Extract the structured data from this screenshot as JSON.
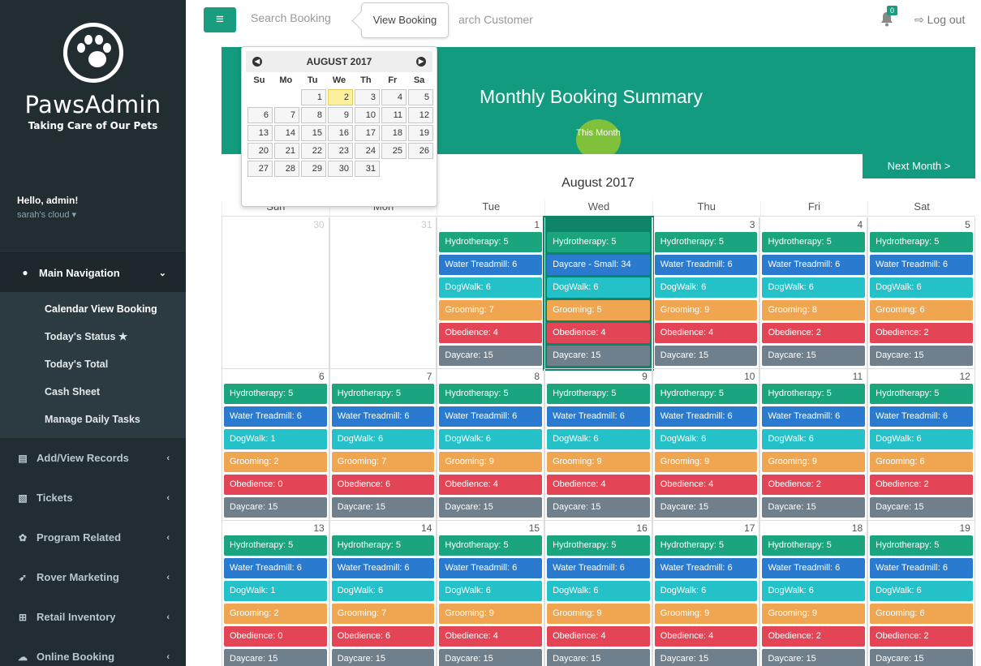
{
  "sidebar": {
    "brand_name": "PawsAdmin",
    "brand_tagline": "Taking Care of Our Pets",
    "user_hello": "Hello, admin!",
    "user_sub": "sarah's cloud ▾",
    "main_nav_label": "Main Navigation",
    "submenu": [
      "Calendar View Booking",
      "Today's Status ★",
      "Today's Total",
      "Cash Sheet",
      "Manage Daily Tasks"
    ],
    "items": [
      {
        "label": "Add/View Records",
        "icon": "document-icon"
      },
      {
        "label": "Tickets",
        "icon": "ticket-icon"
      },
      {
        "label": "Program Related",
        "icon": "program-icon"
      },
      {
        "label": "Rover Marketing",
        "icon": "rover-icon"
      },
      {
        "label": "Retail Inventory",
        "icon": "cart-icon"
      },
      {
        "label": "Online Booking",
        "icon": "cloud-icon"
      }
    ]
  },
  "topbar": {
    "search_booking_placeholder": "Search Booking",
    "view_booking_tip": "View Booking",
    "search_customer_text": "arch Customer",
    "notification_count": "0",
    "logout_label": "Log out"
  },
  "summary": {
    "title": "Monthly Booking Summary",
    "this_month": "This Month",
    "next_month": "Next Month >",
    "month_title": "August 2017"
  },
  "datepicker": {
    "month_label": "AUGUST 2017",
    "dow": [
      "Su",
      "Mo",
      "Tu",
      "We",
      "Th",
      "Fr",
      "Sa"
    ],
    "days": [
      "",
      "",
      "1",
      "2",
      "3",
      "4",
      "5",
      "6",
      "7",
      "8",
      "9",
      "10",
      "11",
      "12",
      "13",
      "14",
      "15",
      "16",
      "17",
      "18",
      "19",
      "20",
      "21",
      "22",
      "23",
      "24",
      "25",
      "26",
      "27",
      "28",
      "29",
      "30",
      "31"
    ],
    "selected": "2"
  },
  "calendar": {
    "headers": [
      "Sun",
      "Mon",
      "Tue",
      "Wed",
      "Thu",
      "Fri",
      "Sat"
    ],
    "weeks": [
      [
        {
          "num": "30",
          "other": true,
          "events": []
        },
        {
          "num": "31",
          "other": true,
          "events": []
        },
        {
          "num": "1",
          "events": [
            [
              "hydro",
              "Hydrotherapy: 5"
            ],
            [
              "water",
              "Water Treadmill: 6"
            ],
            [
              "dogwalk",
              "DogWalk: 6"
            ],
            [
              "groom",
              "Grooming: 7"
            ],
            [
              "obed",
              "Obedience: 4"
            ],
            [
              "dayc",
              "Daycare: 15"
            ]
          ]
        },
        {
          "num": "2",
          "today": true,
          "events": [
            [
              "hydro",
              "Hydrotherapy: 5"
            ],
            [
              "water",
              "Daycare - Small: 34"
            ],
            [
              "dogwalk",
              "DogWalk: 6"
            ],
            [
              "groom",
              "Grooming: 5"
            ],
            [
              "obed",
              "Obedience: 4"
            ],
            [
              "dayc",
              "Daycare: 15"
            ]
          ]
        },
        {
          "num": "3",
          "events": [
            [
              "hydro",
              "Hydrotherapy: 5"
            ],
            [
              "water",
              "Water Treadmill: 6"
            ],
            [
              "dogwalk",
              "DogWalk: 6"
            ],
            [
              "groom",
              "Grooming: 9"
            ],
            [
              "obed",
              "Obedience: 4"
            ],
            [
              "dayc",
              "Daycare: 15"
            ]
          ]
        },
        {
          "num": "4",
          "events": [
            [
              "hydro",
              "Hydrotherapy: 5"
            ],
            [
              "water",
              "Water Treadmill: 6"
            ],
            [
              "dogwalk",
              "DogWalk: 6"
            ],
            [
              "groom",
              "Grooming: 8"
            ],
            [
              "obed",
              "Obedience: 2"
            ],
            [
              "dayc",
              "Daycare: 15"
            ]
          ]
        },
        {
          "num": "5",
          "events": [
            [
              "hydro",
              "Hydrotherapy: 5"
            ],
            [
              "water",
              "Water Treadmill: 6"
            ],
            [
              "dogwalk",
              "DogWalk: 6"
            ],
            [
              "groom",
              "Grooming: 6"
            ],
            [
              "obed",
              "Obedience: 2"
            ],
            [
              "dayc",
              "Daycare: 15"
            ]
          ]
        }
      ],
      [
        {
          "num": "6",
          "events": [
            [
              "hydro",
              "Hydrotherapy: 5"
            ],
            [
              "water",
              "Water Treadmill: 6"
            ],
            [
              "dogwalk",
              "DogWalk: 1"
            ],
            [
              "groom",
              "Grooming: 2"
            ],
            [
              "obed",
              "Obedience: 0"
            ],
            [
              "dayc",
              "Daycare: 15"
            ]
          ]
        },
        {
          "num": "7",
          "events": [
            [
              "hydro",
              "Hydrotherapy: 5"
            ],
            [
              "water",
              "Water Treadmill: 6"
            ],
            [
              "dogwalk",
              "DogWalk: 6"
            ],
            [
              "groom",
              "Grooming: 7"
            ],
            [
              "obed",
              "Obedience: 6"
            ],
            [
              "dayc",
              "Daycare: 15"
            ]
          ]
        },
        {
          "num": "8",
          "events": [
            [
              "hydro",
              "Hydrotherapy: 5"
            ],
            [
              "water",
              "Water Treadmill: 6"
            ],
            [
              "dogwalk",
              "DogWalk: 6"
            ],
            [
              "groom",
              "Grooming: 9"
            ],
            [
              "obed",
              "Obedience: 4"
            ],
            [
              "dayc",
              "Daycare: 15"
            ]
          ]
        },
        {
          "num": "9",
          "events": [
            [
              "hydro",
              "Hydrotherapy: 5"
            ],
            [
              "water",
              "Water Treadmill: 6"
            ],
            [
              "dogwalk",
              "DogWalk: 6"
            ],
            [
              "groom",
              "Grooming: 9"
            ],
            [
              "obed",
              "Obedience: 4"
            ],
            [
              "dayc",
              "Daycare: 15"
            ]
          ]
        },
        {
          "num": "10",
          "events": [
            [
              "hydro",
              "Hydrotherapy: 5"
            ],
            [
              "water",
              "Water Treadmill: 6"
            ],
            [
              "dogwalk",
              "DogWalk: 6"
            ],
            [
              "groom",
              "Grooming: 9"
            ],
            [
              "obed",
              "Obedience: 4"
            ],
            [
              "dayc",
              "Daycare: 15"
            ]
          ]
        },
        {
          "num": "11",
          "events": [
            [
              "hydro",
              "Hydrotherapy: 5"
            ],
            [
              "water",
              "Water Treadmill: 6"
            ],
            [
              "dogwalk",
              "DogWalk: 6"
            ],
            [
              "groom",
              "Grooming: 9"
            ],
            [
              "obed",
              "Obedience: 2"
            ],
            [
              "dayc",
              "Daycare: 15"
            ]
          ]
        },
        {
          "num": "12",
          "events": [
            [
              "hydro",
              "Hydrotherapy: 5"
            ],
            [
              "water",
              "Water Treadmill: 6"
            ],
            [
              "dogwalk",
              "DogWalk: 6"
            ],
            [
              "groom",
              "Grooming: 6"
            ],
            [
              "obed",
              "Obedience: 2"
            ],
            [
              "dayc",
              "Daycare: 15"
            ]
          ]
        }
      ],
      [
        {
          "num": "13",
          "events": [
            [
              "hydro",
              "Hydrotherapy: 5"
            ],
            [
              "water",
              "Water Treadmill: 6"
            ],
            [
              "dogwalk",
              "DogWalk: 1"
            ],
            [
              "groom",
              "Grooming: 2"
            ],
            [
              "obed",
              "Obedience: 0"
            ],
            [
              "dayc",
              "Daycare: 15"
            ]
          ]
        },
        {
          "num": "14",
          "events": [
            [
              "hydro",
              "Hydrotherapy: 5"
            ],
            [
              "water",
              "Water Treadmill: 6"
            ],
            [
              "dogwalk",
              "DogWalk: 6"
            ],
            [
              "groom",
              "Grooming: 7"
            ],
            [
              "obed",
              "Obedience: 6"
            ],
            [
              "dayc",
              "Daycare: 15"
            ]
          ]
        },
        {
          "num": "15",
          "events": [
            [
              "hydro",
              "Hydrotherapy: 5"
            ],
            [
              "water",
              "Water Treadmill: 6"
            ],
            [
              "dogwalk",
              "DogWalk: 6"
            ],
            [
              "groom",
              "Grooming: 9"
            ],
            [
              "obed",
              "Obedience: 4"
            ],
            [
              "dayc",
              "Daycare: 15"
            ]
          ]
        },
        {
          "num": "16",
          "events": [
            [
              "hydro",
              "Hydrotherapy: 5"
            ],
            [
              "water",
              "Water Treadmill: 6"
            ],
            [
              "dogwalk",
              "DogWalk: 6"
            ],
            [
              "groom",
              "Grooming: 9"
            ],
            [
              "obed",
              "Obedience: 4"
            ],
            [
              "dayc",
              "Daycare: 15"
            ]
          ]
        },
        {
          "num": "17",
          "events": [
            [
              "hydro",
              "Hydrotherapy: 5"
            ],
            [
              "water",
              "Water Treadmill: 6"
            ],
            [
              "dogwalk",
              "DogWalk: 6"
            ],
            [
              "groom",
              "Grooming: 9"
            ],
            [
              "obed",
              "Obedience: 4"
            ],
            [
              "dayc",
              "Daycare: 15"
            ]
          ]
        },
        {
          "num": "18",
          "events": [
            [
              "hydro",
              "Hydrotherapy: 5"
            ],
            [
              "water",
              "Water Treadmill: 6"
            ],
            [
              "dogwalk",
              "DogWalk: 6"
            ],
            [
              "groom",
              "Grooming: 9"
            ],
            [
              "obed",
              "Obedience: 2"
            ],
            [
              "dayc",
              "Daycare: 15"
            ]
          ]
        },
        {
          "num": "19",
          "events": [
            [
              "hydro",
              "Hydrotherapy: 5"
            ],
            [
              "water",
              "Water Treadmill: 6"
            ],
            [
              "dogwalk",
              "DogWalk: 6"
            ],
            [
              "groom",
              "Grooming: 6"
            ],
            [
              "obed",
              "Obedience: 2"
            ],
            [
              "dayc",
              "Daycare: 15"
            ]
          ]
        }
      ]
    ]
  }
}
